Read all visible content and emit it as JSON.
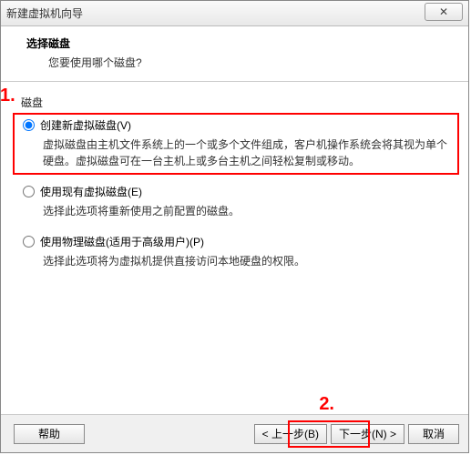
{
  "window": {
    "title": "新建虚拟机向导",
    "close_glyph": "✕"
  },
  "header": {
    "title": "选择磁盘",
    "subtitle": "您要使用哪个磁盘?"
  },
  "group_label": "磁盘",
  "options": [
    {
      "label": "创建新虚拟磁盘(V)",
      "desc": "虚拟磁盘由主机文件系统上的一个或多个文件组成，客户机操作系统会将其视为单个硬盘。虚拟磁盘可在一台主机上或多台主机之间轻松复制或移动。",
      "selected": true
    },
    {
      "label": "使用现有虚拟磁盘(E)",
      "desc": "选择此选项将重新使用之前配置的磁盘。",
      "selected": false
    },
    {
      "label": "使用物理磁盘(适用于高级用户)(P)",
      "desc": "选择此选项将为虚拟机提供直接访问本地硬盘的权限。",
      "selected": false
    }
  ],
  "footer": {
    "help": "帮助",
    "back": "< 上一步(B)",
    "next": "下一步(N) >",
    "cancel": "取消"
  },
  "annotations": {
    "one": "1.",
    "two": "2."
  }
}
